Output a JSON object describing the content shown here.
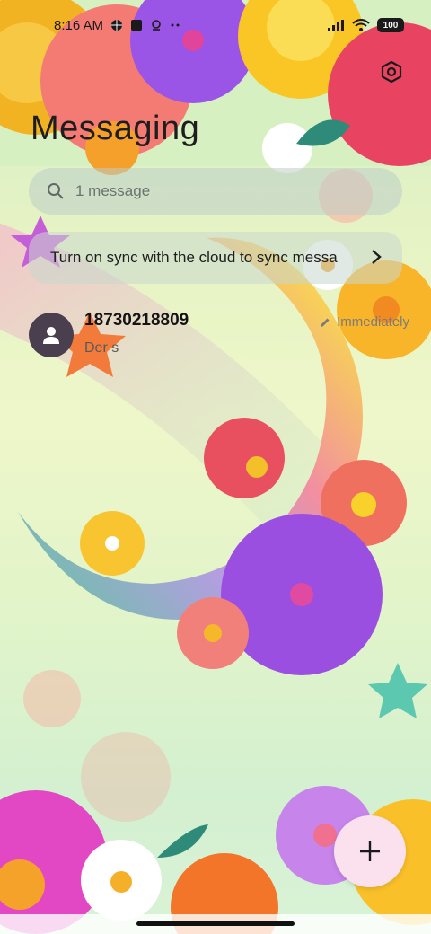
{
  "status_bar": {
    "time": "8:16 AM",
    "battery": "100",
    "left_icons": [
      "browser-icon",
      "notification-square-icon",
      "location-icon",
      "more-dots-icon"
    ],
    "right_icons": [
      "signal-icon",
      "wifi-icon",
      "battery-icon"
    ]
  },
  "header": {
    "title": "Messaging",
    "settings_icon": "settings-hexagon-icon"
  },
  "search": {
    "placeholder": "1 message",
    "icon": "search-icon"
  },
  "sync_banner": {
    "text": "Turn on sync with the cloud to sync messa",
    "icon": "chevron-right-icon"
  },
  "conversations": [
    {
      "sender": "18730218809",
      "snippet": "Der s",
      "time": "Immediately",
      "avatar_icon": "person-icon",
      "draft_icon": "pencil-icon"
    }
  ],
  "fab": {
    "label": "+",
    "icon": "plus-icon"
  },
  "colors": {
    "fab_background": "#fbe1ee",
    "avatar_background": "#4a3f4e",
    "text_primary": "#1e1e1e"
  }
}
